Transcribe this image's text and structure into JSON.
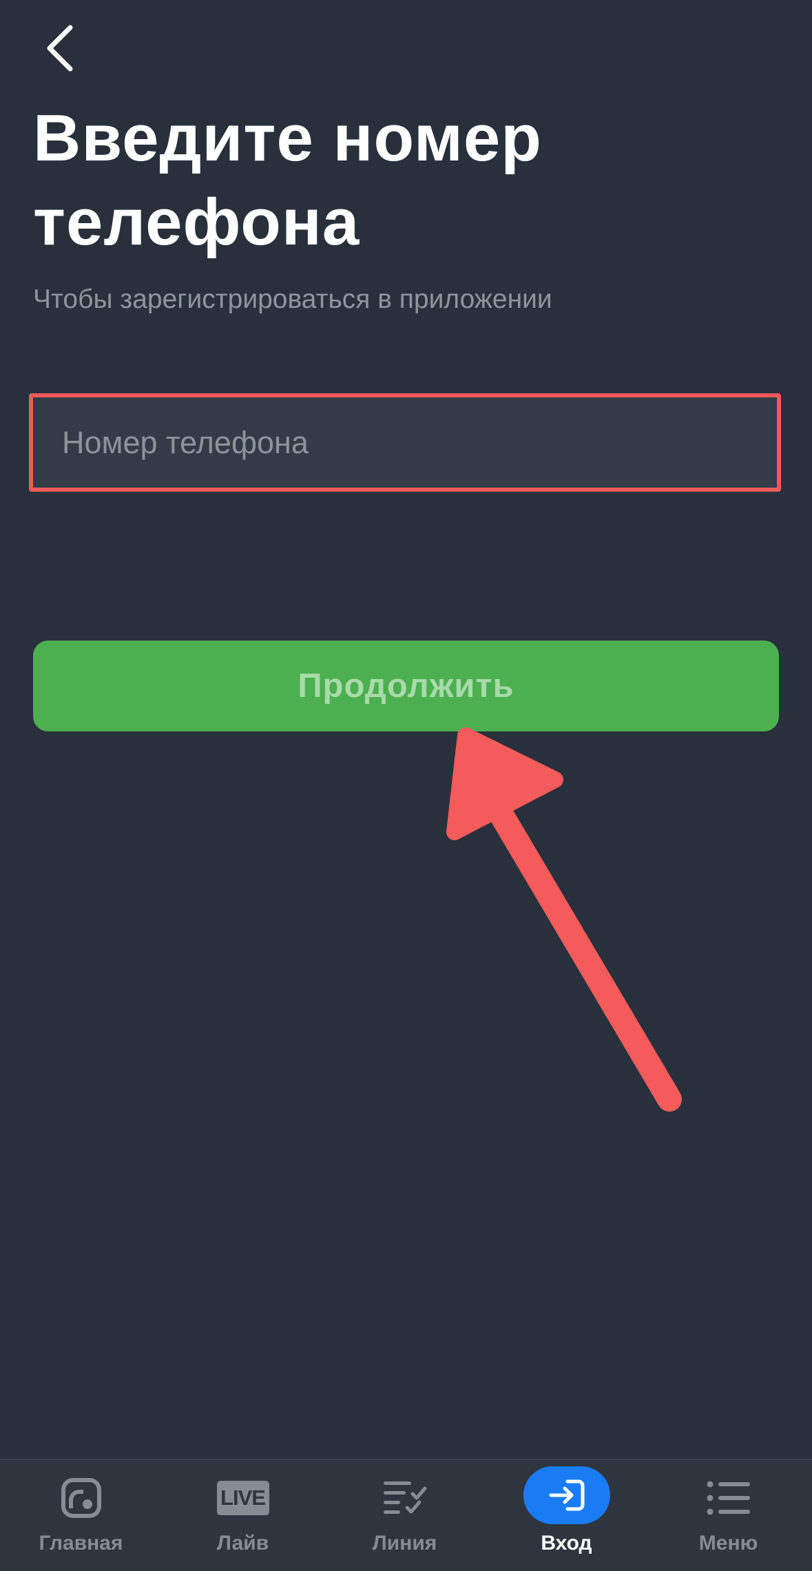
{
  "header": {
    "title_line1": "Введите номер",
    "title_line2": "телефона",
    "subtitle": "Чтобы зарегистрироваться в приложении"
  },
  "phone_input": {
    "placeholder": "Номер телефона",
    "value": ""
  },
  "continue_button": {
    "label": "Продолжить"
  },
  "tab_bar": {
    "items": [
      {
        "label": "Главная",
        "icon": "home-dashboard-icon",
        "active": false
      },
      {
        "label": "Лайв",
        "icon": "live-badge-icon",
        "badge_text": "LIVE",
        "active": false
      },
      {
        "label": "Линия",
        "icon": "checklist-icon",
        "active": false
      },
      {
        "label": "Вход",
        "icon": "login-icon",
        "active": true
      },
      {
        "label": "Меню",
        "icon": "menu-list-icon",
        "active": false
      }
    ]
  },
  "colors": {
    "background": "#28303b",
    "highlight_border": "#ee5a5a",
    "annotation_arrow": "#f45b5b",
    "continue_button": "#4caf50",
    "active_tab": "#1a7cf5"
  }
}
